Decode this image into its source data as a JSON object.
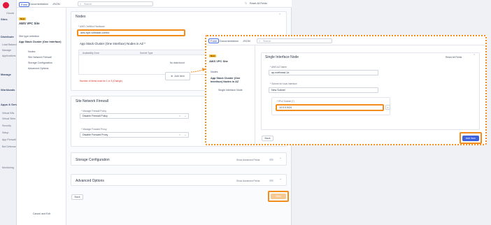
{
  "nav": {
    "items": [
      "Clouds",
      "Sites",
      "Distribute",
      "Load Balancing",
      "Manage",
      "Applications",
      "Manage",
      "Workloads",
      "Apps & Services",
      "Virtual K8s",
      "Virtual Sites",
      "Security",
      "Setup",
      "App Firewall",
      "Bot Defense",
      "Monitoring"
    ]
  },
  "topbar": {
    "tabs": [
      "Form",
      "Documentation",
      "JSON"
    ],
    "search_placeholder": "Search",
    "reset_label": "Reset All Fields"
  },
  "sidebar": {
    "badge": "New",
    "title": "AWS VPC Site",
    "section_label": "Site type selection",
    "group": "App Stack Cluster (One Interface)",
    "items": [
      "Nodes",
      "Site Network Firewall",
      "Storage Configuration",
      "Advanced Options"
    ],
    "footer_button": "Cancel and Exit"
  },
  "main": {
    "nodes_title": "Nodes",
    "aws_cert_label": "* AWS Certified Hardware",
    "aws_cert_value": "aws-byol-voltstack-combo",
    "cluster_title": "App Stack Cluster (One Interface) Nodes in AZ *",
    "col_az": "Availability Zone",
    "col_subnet": "Subnet Type",
    "no_data": "No data found",
    "add_item": "Add Item",
    "nodes_warning": "Number of items must be 1 or 3 (Change)",
    "firewall_title": "Site Network Firewall",
    "fw_policy_label": "* Manage Firewall Policy",
    "fw_policy_value": "Disable Firewall Policy",
    "fw_forward_label": "* Manage Forward Proxy",
    "fw_forward_value": "Disable Forward Proxy",
    "storage_title": "Storage Configuration",
    "advanced_title": "Advanced Options",
    "show_advanced": "Show Advanced Fields",
    "back_button": "Back",
    "next_button": "Next"
  },
  "popup": {
    "tabs": [
      "Form",
      "Documentation",
      "JSON"
    ],
    "search_placeholder": "Search",
    "reset_label": "Reset All Fields",
    "badge": "New",
    "site_title": "AWS VPC Site",
    "nodes_label": "Nodes",
    "group": "App Stack Cluster (One Interface) Nodes in AZ",
    "sub_item": "Single Interface Node",
    "section_title": "Single Interface Node",
    "az_label": "* AWS AZ Name",
    "az_value": "ap-northeast-1a",
    "subnet_label": "* Subnet for local interface",
    "subnet_value": "New Subnet",
    "ipv4_label": "* IPv4 Subnet (*)",
    "ipv4_value": "10.0.0.0/24",
    "back_button": "Back",
    "add_button": "Add Item"
  }
}
